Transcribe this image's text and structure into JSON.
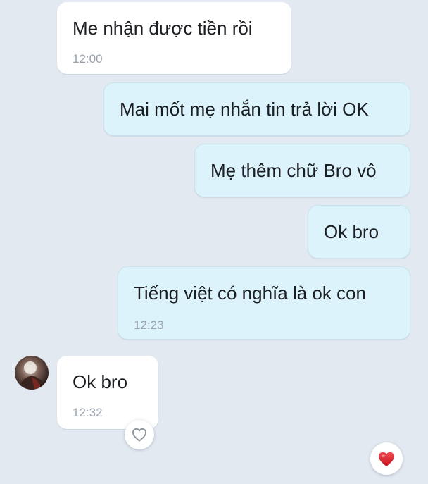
{
  "conversation": {
    "messages": [
      {
        "side": "incoming",
        "text": "Me nhận được tiền rồi",
        "time": "12:00"
      },
      {
        "side": "outgoing",
        "text": "Mai mốt mẹ nhắn tin trả lời OK"
      },
      {
        "side": "outgoing",
        "text": "Mẹ thêm chữ Bro vô"
      },
      {
        "side": "outgoing",
        "text": "Ok bro"
      },
      {
        "side": "outgoing",
        "text": "Tiếng việt có nghĩa là ok con",
        "time": "12:23"
      },
      {
        "side": "incoming",
        "text": "Ok bro",
        "time": "12:32",
        "reaction": "heart-outline-icon"
      }
    ]
  },
  "reactions": {
    "add_reaction_icon": "heart-outline-icon",
    "sent_reaction_icon": "red-heart-icon"
  },
  "colors": {
    "background": "#e3e9f1",
    "incoming_bubble": "#ffffff",
    "outgoing_bubble": "#dcf3fb",
    "timestamp": "#9aa3ad",
    "heart": "#e0212b"
  }
}
